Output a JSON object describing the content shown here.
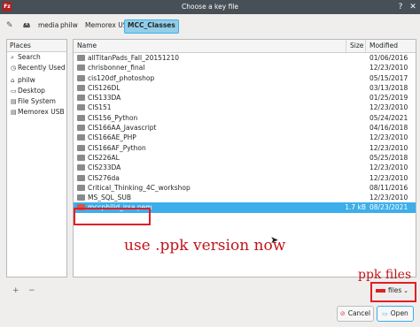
{
  "window": {
    "title": "Choose a key file",
    "app_icon_text": "Fz"
  },
  "breadcrumbs": [
    "media",
    "philw",
    "Memorex USB",
    "MCC_Classes"
  ],
  "places": {
    "header": "Places",
    "items": [
      {
        "label": "Search",
        "icon": "search-icon"
      },
      {
        "label": "Recently Used",
        "icon": "clock-icon"
      },
      {
        "label": "philw",
        "icon": "home-icon"
      },
      {
        "label": "Desktop",
        "icon": "desktop-icon"
      },
      {
        "label": "File System",
        "icon": "drive-icon"
      },
      {
        "label": "Memorex USB",
        "icon": "usb-icon"
      }
    ]
  },
  "columns": {
    "name": "Name",
    "size": "Size",
    "modified": "Modified"
  },
  "files": [
    {
      "name": "allTitanPads_Fall_20151210",
      "size": "",
      "modified": "01/06/2016"
    },
    {
      "name": "chrisbonner_final",
      "size": "",
      "modified": "12/23/2010"
    },
    {
      "name": "cis120df_photoshop",
      "size": "",
      "modified": "05/15/2017"
    },
    {
      "name": "CIS126DL",
      "size": "",
      "modified": "03/13/2018"
    },
    {
      "name": "CIS133DA",
      "size": "",
      "modified": "01/25/2019"
    },
    {
      "name": "CIS151",
      "size": "",
      "modified": "12/23/2010"
    },
    {
      "name": "CIS156_Python",
      "size": "",
      "modified": "05/24/2021"
    },
    {
      "name": "CIS166AA_Javascript",
      "size": "",
      "modified": "04/16/2018"
    },
    {
      "name": "CIS166AE_PHP",
      "size": "",
      "modified": "12/23/2010"
    },
    {
      "name": "CIS166AF_Python",
      "size": "",
      "modified": "12/23/2010"
    },
    {
      "name": "CIS226AL",
      "size": "",
      "modified": "05/25/2018"
    },
    {
      "name": "CIS233DA",
      "size": "",
      "modified": "12/23/2010"
    },
    {
      "name": "CIS276da",
      "size": "",
      "modified": "12/23/2010"
    },
    {
      "name": "Critical_Thinking_4C_workshop",
      "size": "",
      "modified": "08/11/2016"
    },
    {
      "name": "MS_SQL_SUB",
      "size": "",
      "modified": "12/23/2010"
    },
    {
      "name": "mccphilid_irsa.pem",
      "size": "1.7 kB",
      "modified": "08/23/2021",
      "selected": true
    }
  ],
  "annotations": {
    "main": "use .ppk version now",
    "filter": "ppk files"
  },
  "filter": {
    "value": "files"
  },
  "buttons": {
    "cancel": "Cancel",
    "open": "Open"
  },
  "bottom_left": {
    "add": "+",
    "remove": "−"
  },
  "colors": {
    "selection": "#3daee9",
    "annotation": "#e31e24",
    "titlebar": "#475057"
  }
}
